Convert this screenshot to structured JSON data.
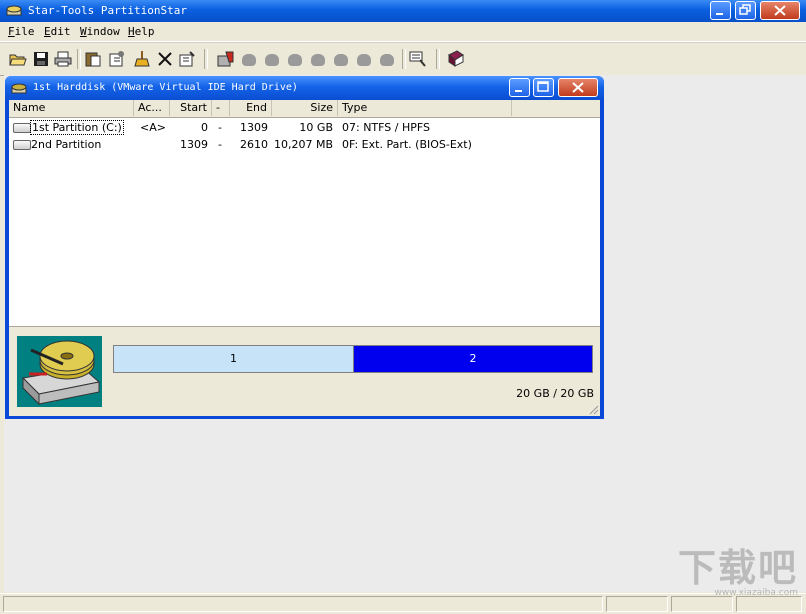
{
  "app": {
    "title": "Star-Tools PartitionStar"
  },
  "menu": {
    "items": [
      {
        "accel": "F",
        "rest": "ile"
      },
      {
        "accel": "E",
        "rest": "dit"
      },
      {
        "accel": "W",
        "rest": "indow"
      },
      {
        "accel": "H",
        "rest": "elp"
      }
    ]
  },
  "toolbar": {
    "icons": [
      "open-folder-icon",
      "save-disk-icon",
      "print-icon",
      "paste-icon",
      "properties-icon",
      "clean-icon",
      "delete-x-icon",
      "edit-icon",
      "harddisk-tool-icon",
      "tools-icon",
      "book-icon"
    ]
  },
  "child_window": {
    "title": "1st Harddisk (VMware Virtual IDE Hard Drive)",
    "columns": [
      "Name",
      "Ac...",
      "Start",
      "-",
      "End",
      "Size",
      "Type"
    ],
    "rows": [
      {
        "name": "1st Partition (C:)",
        "active": "<A>",
        "start": "0",
        "dash": "-",
        "end": "1309",
        "size": "10 GB",
        "type": "07: NTFS / HPFS"
      },
      {
        "name": "2nd Partition",
        "active": "",
        "start": "1309",
        "dash": "-",
        "end": "2610",
        "size": "10,207 MB",
        "type": "0F: Ext. Part. (BIOS-Ext)"
      }
    ],
    "partition_bar": {
      "segments": [
        {
          "label": "1",
          "fraction": 0.502,
          "color": "#c6e3f7"
        },
        {
          "label": "2",
          "fraction": 0.498,
          "color": "#0000ee"
        }
      ]
    },
    "capacity": "20 GB / 20 GB"
  },
  "watermark": {
    "brand": "下载吧",
    "url": "www.xiazaiba.com"
  },
  "colors": {
    "titlebar": "#0a5fe0",
    "face": "#ece9d8",
    "partition1": "#c6e3f7",
    "partition2": "#0000ee"
  }
}
